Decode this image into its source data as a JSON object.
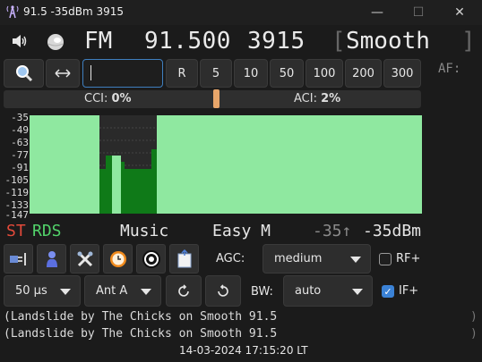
{
  "window": {
    "title": "91.5 -35dBm 3915",
    "minimize": "—",
    "maximize": "☐",
    "close": "✕"
  },
  "tuner": {
    "band": "FM",
    "frequency": "91.500",
    "pi": "3915",
    "ps_open": "[",
    "ps": "Smooth",
    "ps_close": "]"
  },
  "controls": {
    "freq_input_value": "",
    "reset_label": "R",
    "steps": [
      "5",
      "10",
      "50",
      "100",
      "200",
      "300"
    ],
    "af_label": "AF:"
  },
  "interference": {
    "cci_label": "CCI:",
    "cci_value": "0%",
    "aci_label": "ACI:",
    "aci_value": "2%"
  },
  "spectrum": {
    "ticks": [
      "-35",
      "-49",
      "-63",
      "-77",
      "-91",
      "-105",
      "-119",
      "-133",
      "-147"
    ]
  },
  "status": {
    "st": "ST",
    "rds": "RDS",
    "pty": "Music",
    "ptyn": "Easy M",
    "signal_prev": "-35↑",
    "signal_now": "-35dBm"
  },
  "settings": {
    "agc_label": "AGC:",
    "agc_value": "medium",
    "rf_plus": "RF+",
    "rf_plus_checked": false,
    "deemphasis": "50 µs",
    "antenna": "Ant A",
    "bw_label": "BW:",
    "bw_value": "auto",
    "if_plus": "IF+",
    "if_plus_checked": true
  },
  "radiotext": {
    "line1": "(Landslide by The Chicks on Smooth 91.5",
    "line2": "(Landslide by The Chicks on Smooth 91.5",
    "close1": ")",
    "close2": ")"
  },
  "clock": "14-03-2024 17:15:20 LT",
  "colors": {
    "accent": "#3b82d6",
    "spectrum_bg": "#8fe8a0",
    "stereo": "#e24a3a",
    "rds": "#52d26a"
  }
}
